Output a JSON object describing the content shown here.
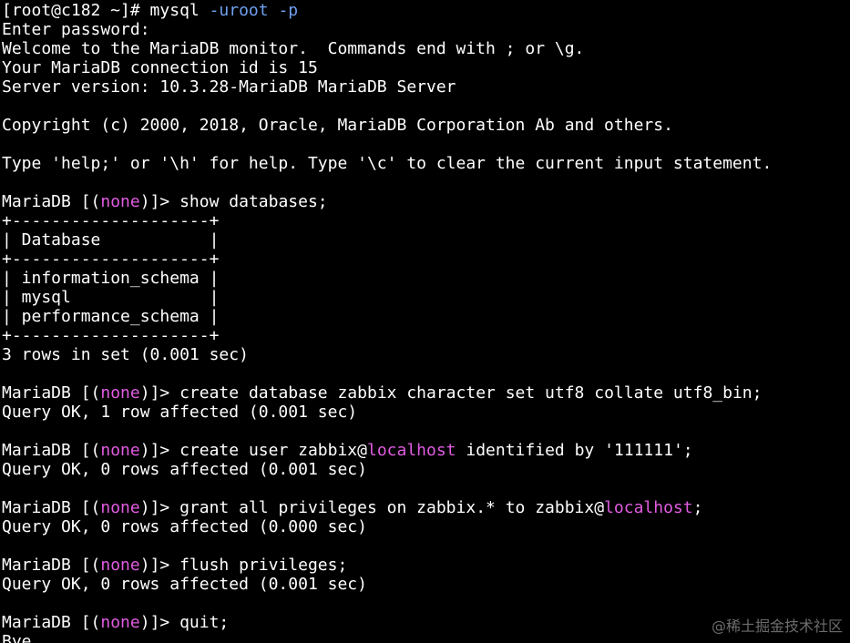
{
  "terminal": {
    "lines": [
      [
        {
          "t": "[root@c182 ~]# mysql "
        },
        {
          "t": "-uroot",
          "c": "c-flag"
        },
        {
          "t": " "
        },
        {
          "t": "-p",
          "c": "c-flag"
        }
      ],
      [
        {
          "t": "Enter password:"
        }
      ],
      [
        {
          "t": "Welcome to the MariaDB monitor.  Commands end with ; or \\g."
        }
      ],
      [
        {
          "t": "Your MariaDB connection id is 15"
        }
      ],
      [
        {
          "t": "Server version: 10.3.28-MariaDB MariaDB Server"
        }
      ],
      [],
      [
        {
          "t": "Copyright (c) 2000, 2018, Oracle, MariaDB Corporation Ab and others."
        }
      ],
      [],
      [
        {
          "t": "Type 'help;' or '\\h' for help. Type '\\c' to clear the current input statement."
        }
      ],
      [],
      [
        {
          "t": "MariaDB [("
        },
        {
          "t": "none",
          "c": "c-kw"
        },
        {
          "t": ")]> show databases;"
        }
      ],
      [
        {
          "t": "+--------------------+"
        }
      ],
      [
        {
          "t": "| Database           |"
        }
      ],
      [
        {
          "t": "+--------------------+"
        }
      ],
      [
        {
          "t": "| information_schema |"
        }
      ],
      [
        {
          "t": "| mysql              |"
        }
      ],
      [
        {
          "t": "| performance_schema |"
        }
      ],
      [
        {
          "t": "+--------------------+"
        }
      ],
      [
        {
          "t": "3 rows in set (0.001 sec)"
        }
      ],
      [],
      [
        {
          "t": "MariaDB [("
        },
        {
          "t": "none",
          "c": "c-kw"
        },
        {
          "t": ")]> create database zabbix character set utf8 collate utf8_bin;"
        }
      ],
      [
        {
          "t": "Query OK, 1 row affected (0.001 sec)"
        }
      ],
      [],
      [
        {
          "t": "MariaDB [("
        },
        {
          "t": "none",
          "c": "c-kw"
        },
        {
          "t": ")]> create user zabbix@"
        },
        {
          "t": "localhost",
          "c": "c-kw"
        },
        {
          "t": " identified by '111111';"
        }
      ],
      [
        {
          "t": "Query OK, 0 rows affected (0.001 sec)"
        }
      ],
      [],
      [
        {
          "t": "MariaDB [("
        },
        {
          "t": "none",
          "c": "c-kw"
        },
        {
          "t": ")]> grant all privileges on zabbix.* to zabbix@"
        },
        {
          "t": "localhost",
          "c": "c-kw"
        },
        {
          "t": ";"
        }
      ],
      [
        {
          "t": "Query OK, 0 rows affected (0.000 sec)"
        }
      ],
      [],
      [
        {
          "t": "MariaDB [("
        },
        {
          "t": "none",
          "c": "c-kw"
        },
        {
          "t": ")]> flush privileges;"
        }
      ],
      [
        {
          "t": "Query OK, 0 rows affected (0.001 sec)"
        }
      ],
      [],
      [
        {
          "t": "MariaDB [("
        },
        {
          "t": "none",
          "c": "c-kw"
        },
        {
          "t": ")]> quit;"
        }
      ],
      [
        {
          "t": "Bye"
        }
      ]
    ],
    "colors": {
      "background": "#000000",
      "text": "#ffffff",
      "keyword": "#e15ce1",
      "flag": "#6fa0f0"
    }
  },
  "watermark": "@稀土掘金技术社区"
}
